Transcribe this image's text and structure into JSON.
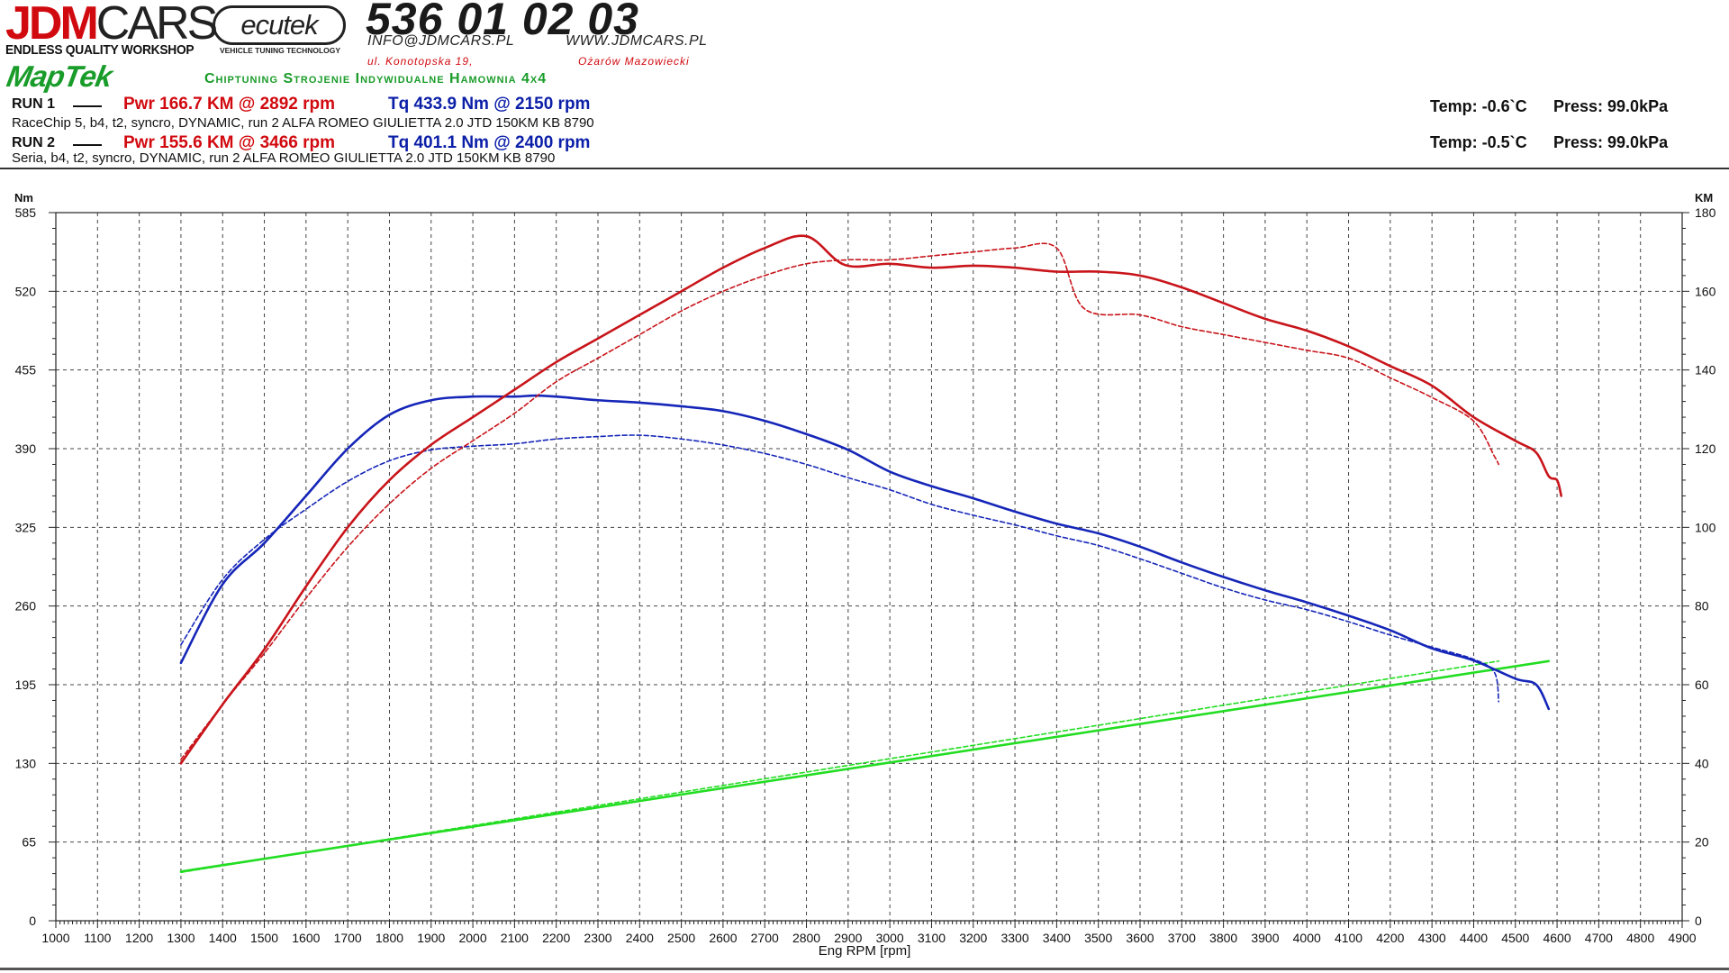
{
  "header": {
    "logo_main_red": "JDM",
    "logo_main_dark": "CARS",
    "logo_sub": "ENDLESS QUALITY WORKSHOP",
    "ecutek": "ecutek",
    "ecutek_sub": "VEHICLE TUNING TECHNOLOGY",
    "phone": "536 01 02 03",
    "email": "INFO@JDMCARS.PL",
    "website": "WWW.JDMCARS.PL",
    "address": "ul. Konotopska 19,",
    "city": "Ożarów Mazowiecki",
    "maptek": "MapTek",
    "services": "Chiptuning Strojenie Indywidualne Hamownia 4x4"
  },
  "runs": [
    {
      "label": "RUN 1",
      "power": "Pwr  166.7 KM @ 2892 rpm",
      "torque": "Tq 433.9 Nm @ 2150 rpm",
      "description": "RaceChip 5, b4, t2, syncro, DYNAMIC,  run 2 ALFA ROMEO GIULIETTA 2.0 JTD 150KM KB 8790",
      "temp": "Temp: -0.6`C",
      "press": "Press: 99.0kPa"
    },
    {
      "label": "RUN 2",
      "power": "Pwr  155.6 KM @ 3466 rpm",
      "torque": "Tq 401.1 Nm @ 2400 rpm",
      "description": "Seria, b4, t2, syncro, DYNAMIC,  run 2 ALFA ROMEO GIULIETTA 2.0 JTD 150KM KB 8790",
      "temp": "Temp: -0.5`C",
      "press": "Press: 99.0kPa"
    }
  ],
  "chart_data": {
    "type": "line",
    "title": "",
    "xlabel": "Eng RPM [rpm]",
    "ylabel_left": "Nm",
    "ylabel_right": "KM",
    "xlim": [
      1000,
      4900
    ],
    "ylim_left": [
      0,
      585
    ],
    "ylim_right": [
      0,
      180
    ],
    "x_ticks": [
      1000,
      1100,
      1200,
      1300,
      1400,
      1500,
      1600,
      1700,
      1800,
      1900,
      2000,
      2100,
      2200,
      2300,
      2400,
      2500,
      2600,
      2700,
      2800,
      2900,
      3000,
      3100,
      3200,
      3300,
      3400,
      3500,
      3600,
      3700,
      3800,
      3900,
      4000,
      4100,
      4200,
      4300,
      4400,
      4500,
      4600,
      4700,
      4800,
      4900
    ],
    "y_ticks_left": [
      0,
      65,
      130,
      195,
      260,
      325,
      390,
      455,
      520,
      585
    ],
    "y_ticks_right": [
      0,
      20,
      40,
      60,
      80,
      100,
      120,
      140,
      160,
      180
    ],
    "grid": true,
    "legend": "header, top-left",
    "colors": {
      "power": "#c8141a",
      "torque": "#1526b8",
      "speed": "#22dd22"
    },
    "series": [
      {
        "run": "RUN 1",
        "quantity": "power",
        "axis": "right",
        "style": "solid",
        "x": [
          1300,
          1400,
          1500,
          1600,
          1700,
          1800,
          1900,
          2000,
          2100,
          2200,
          2300,
          2400,
          2500,
          2600,
          2700,
          2800,
          2892,
          3000,
          3100,
          3200,
          3300,
          3400,
          3500,
          3600,
          3700,
          3800,
          3900,
          4000,
          4100,
          4200,
          4300,
          4400,
          4500,
          4550,
          4580,
          4600,
          4610
        ],
        "values": [
          40,
          55,
          69,
          85,
          100,
          112,
          121,
          128,
          135,
          142,
          148,
          154,
          160,
          166,
          171,
          174,
          166.7,
          167,
          166,
          166.5,
          166,
          165,
          165,
          164,
          161,
          157,
          153,
          150,
          146,
          141,
          136,
          128,
          122,
          119,
          113,
          112,
          108
        ]
      },
      {
        "run": "RUN 2",
        "quantity": "power",
        "axis": "right",
        "style": "dashed",
        "x": [
          1300,
          1400,
          1500,
          1600,
          1700,
          1800,
          1900,
          2000,
          2100,
          2200,
          2300,
          2400,
          2500,
          2600,
          2700,
          2800,
          2900,
          3000,
          3100,
          3200,
          3300,
          3400,
          3466,
          3600,
          3700,
          3800,
          3900,
          4000,
          4100,
          4200,
          4300,
          4400,
          4450,
          4460
        ],
        "values": [
          41,
          55,
          68,
          82,
          95,
          106,
          115,
          122,
          129,
          137,
          143,
          149,
          155,
          160,
          164,
          167,
          168,
          168,
          169,
          170,
          171,
          171,
          155.6,
          154,
          151,
          149,
          147,
          145,
          143,
          138,
          133,
          127,
          118,
          116
        ]
      },
      {
        "run": "RUN 1",
        "quantity": "torque",
        "axis": "left",
        "style": "solid",
        "x": [
          1300,
          1400,
          1500,
          1600,
          1700,
          1800,
          1900,
          2000,
          2100,
          2150,
          2200,
          2300,
          2400,
          2500,
          2600,
          2700,
          2800,
          2900,
          3000,
          3100,
          3200,
          3300,
          3400,
          3500,
          3600,
          3700,
          3800,
          3900,
          4000,
          4100,
          4200,
          4300,
          4400,
          4500,
          4550,
          4580
        ],
        "values": [
          213,
          278,
          312,
          351,
          390,
          418,
          430,
          433,
          433,
          433.9,
          433,
          430,
          428,
          425,
          421,
          413,
          402,
          389,
          371,
          359,
          349,
          338,
          328,
          320,
          309,
          296,
          284,
          273,
          263,
          252,
          240,
          225,
          215,
          200,
          195,
          175
        ]
      },
      {
        "run": "RUN 2",
        "quantity": "torque",
        "axis": "left",
        "style": "dashed",
        "x": [
          1300,
          1400,
          1500,
          1600,
          1700,
          1800,
          1900,
          2000,
          2100,
          2200,
          2300,
          2400,
          2500,
          2600,
          2700,
          2800,
          2900,
          3000,
          3100,
          3200,
          3300,
          3400,
          3500,
          3600,
          3700,
          3800,
          3900,
          4000,
          4100,
          4200,
          4300,
          4400,
          4450,
          4460
        ],
        "values": [
          228,
          282,
          315,
          340,
          363,
          380,
          389,
          392,
          394,
          398,
          400,
          401.1,
          398,
          393,
          386,
          377,
          366,
          356,
          344,
          335,
          327,
          318,
          310,
          299,
          287,
          275,
          265,
          257,
          247,
          236,
          226,
          216,
          205,
          181
        ]
      },
      {
        "run": "RUN 1",
        "quantity": "speed",
        "axis": "right",
        "style": "solid",
        "x": [
          1300,
          4580
        ],
        "values": [
          12.5,
          66
        ]
      },
      {
        "run": "RUN 2",
        "quantity": "speed",
        "axis": "right",
        "style": "dashed",
        "x": [
          1300,
          4460
        ],
        "values": [
          12.3,
          66
        ]
      }
    ]
  }
}
